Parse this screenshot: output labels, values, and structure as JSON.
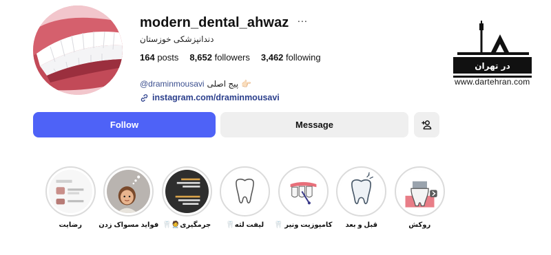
{
  "profile": {
    "username": "modern_dental_ahwaz",
    "more_icon": "ellipsis-icon",
    "category": "دندانپزشکی خوزستان",
    "stats": {
      "posts": "164",
      "posts_label": "posts",
      "followers": "8,652",
      "followers_label": "followers",
      "following": "3,462",
      "following_label": "following"
    },
    "bio": {
      "mention": "@draminmousavi",
      "text": "پیج اصلی",
      "emoji": "👉🏻"
    },
    "link": {
      "icon": "link-icon",
      "text": "instagram.com/draminmousavi"
    }
  },
  "actions": {
    "follow_label": "Follow",
    "message_label": "Message",
    "add_user_icon": "add-person-icon"
  },
  "watermark": {
    "logo_text": "در تهران",
    "url_text": "www.dartehran.com"
  },
  "highlights": [
    {
      "label": "روکش",
      "icon": "tooth-crown-icon"
    },
    {
      "label": "قبل و بعد",
      "icon": "tooth-icon"
    },
    {
      "label": "کامپوزیت ونیر 🦷",
      "icon": "veneer-icon"
    },
    {
      "label": "لیفت لثه🦷",
      "icon": "tooth-outline-icon"
    },
    {
      "label": "جرمگیری🧑‍⚕️🦷",
      "icon": "text-card-icon"
    },
    {
      "label": "فواید مسواک زدن",
      "icon": "memoji-icon"
    },
    {
      "label": "رضایت",
      "icon": "screenshot-icon"
    }
  ],
  "colors": {
    "follow_button": "#4e62f7",
    "secondary_button": "#efefef",
    "link": "#2b3f8c",
    "ring": "#dbdbdb"
  }
}
